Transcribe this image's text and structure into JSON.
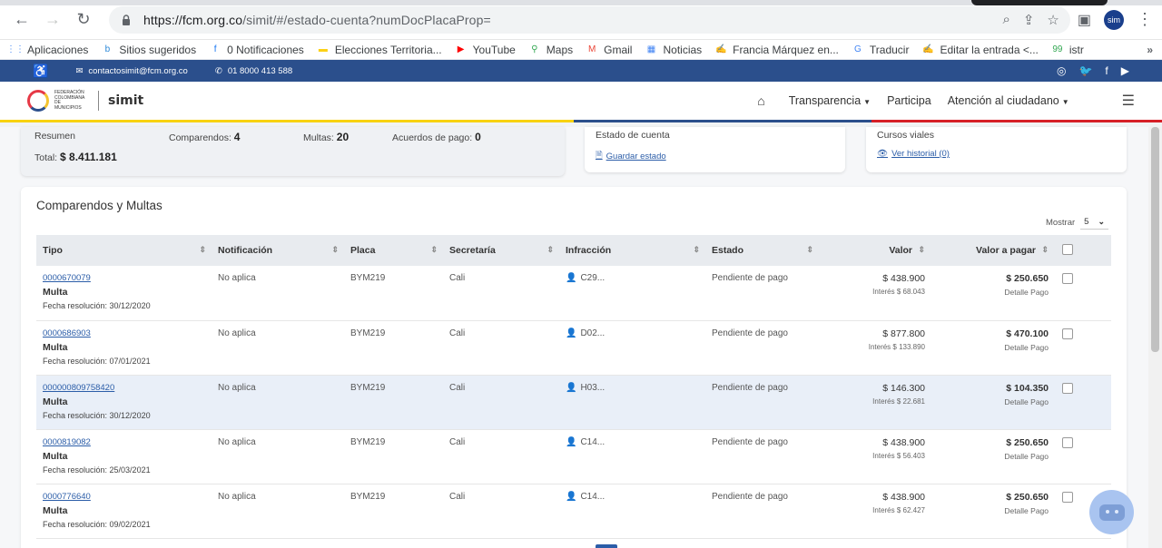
{
  "browser": {
    "url_base": "https://fcm.org.co",
    "url_path": "/simit/#/estado-cuenta?numDocPlacaProp=",
    "profile_label": "sim"
  },
  "bookmarks": [
    {
      "label": "Aplicaciones",
      "icon": "apps-grid-icon",
      "color": "#4285f4"
    },
    {
      "label": "Sitios sugeridos",
      "icon": "bing-icon",
      "color": "#2b88d8"
    },
    {
      "label": "0 Notificaciones",
      "icon": "facebook-icon",
      "color": "#1877f2"
    },
    {
      "label": "Elecciones Territoria...",
      "icon": "flag-icon",
      "color": "#fcd116"
    },
    {
      "label": "YouTube",
      "icon": "youtube-icon",
      "color": "#ff0000"
    },
    {
      "label": "Maps",
      "icon": "maps-pin-icon",
      "color": "#34a853"
    },
    {
      "label": "Gmail",
      "icon": "gmail-icon",
      "color": "#ea4335"
    },
    {
      "label": "Noticias",
      "icon": "news-icon",
      "color": "#4285f4"
    },
    {
      "label": "Francia Márquez en...",
      "icon": "blogger-icon",
      "color": "#3b5998"
    },
    {
      "label": "Traducir",
      "icon": "translate-icon",
      "color": "#4285f4"
    },
    {
      "label": "Editar la entrada <...",
      "icon": "blogger-icon",
      "color": "#3b5998"
    },
    {
      "label": "istr",
      "icon": "istr-icon",
      "color": "#34a853"
    }
  ],
  "topbar": {
    "email": "contactosimit@fcm.org.co",
    "phone": "01 8000 413 588"
  },
  "nav": {
    "transparencia": "Transparencia",
    "participa": "Participa",
    "atencion": "Atención al ciudadano"
  },
  "logo": {
    "fcm": "Federación Colombiana de Municipios",
    "simit": "simit"
  },
  "summary": {
    "resumen": "Resumen",
    "comparendos_label": "Comparendos:",
    "comparendos": "4",
    "multas_label": "Multas:",
    "multas": "20",
    "acuerdos_label": "Acuerdos de pago:",
    "acuerdos": "0",
    "total_label": "Total:",
    "total": "$ 8.411.181"
  },
  "estado_card": {
    "title": "Estado de cuenta",
    "link": "Guardar estado"
  },
  "cursos_card": {
    "title": "Cursos viales",
    "link": "Ver historial (0)"
  },
  "main": {
    "title": "Comparendos y Multas",
    "mostrar_label": "Mostrar",
    "mostrar_value": "5"
  },
  "table": {
    "headers": {
      "tipo": "Tipo",
      "notificacion": "Notificación",
      "placa": "Placa",
      "secretaria": "Secretaría",
      "infraccion": "Infracción",
      "estado": "Estado",
      "valor": "Valor",
      "valor_pagar": "Valor a pagar"
    },
    "rows": [
      {
        "doc": "0000670079",
        "tipo": "Multa",
        "fecha": "Fecha resolución: 30/12/2020",
        "notificacion": "No aplica",
        "placa": "BYM219",
        "secretaria": "Cali",
        "infraccion": "C29...",
        "estado": "Pendiente de pago",
        "valor": "$ 438.900",
        "interes": "Interés $ 68.043",
        "pagar": "$ 250.650",
        "detalle": "Detalle Pago"
      },
      {
        "doc": "0000686903",
        "tipo": "Multa",
        "fecha": "Fecha resolución: 07/01/2021",
        "notificacion": "No aplica",
        "placa": "BYM219",
        "secretaria": "Cali",
        "infraccion": "D02...",
        "estado": "Pendiente de pago",
        "valor": "$ 877.800",
        "interes": "Interés $ 133.890",
        "pagar": "$ 470.100",
        "detalle": "Detalle Pago"
      },
      {
        "doc": "000000809758420",
        "tipo": "Multa",
        "fecha": "Fecha resolución: 30/12/2020",
        "notificacion": "No aplica",
        "placa": "BYM219",
        "secretaria": "Cali",
        "infraccion": "H03...",
        "estado": "Pendiente de pago",
        "valor": "$ 146.300",
        "interes": "Interés $ 22.681",
        "pagar": "$ 104.350",
        "detalle": "Detalle Pago",
        "highlight": true
      },
      {
        "doc": "0000819082",
        "tipo": "Multa",
        "fecha": "Fecha resolución: 25/03/2021",
        "notificacion": "No aplica",
        "placa": "BYM219",
        "secretaria": "Cali",
        "infraccion": "C14...",
        "estado": "Pendiente de pago",
        "valor": "$ 438.900",
        "interes": "Interés $ 56.403",
        "pagar": "$ 250.650",
        "detalle": "Detalle Pago"
      },
      {
        "doc": "0000776640",
        "tipo": "Multa",
        "fecha": "Fecha resolución: 09/02/2021",
        "notificacion": "No aplica",
        "placa": "BYM219",
        "secretaria": "Cali",
        "infraccion": "C14...",
        "estado": "Pendiente de pago",
        "valor": "$ 438.900",
        "interes": "Interés $ 62.427",
        "pagar": "$ 250.650",
        "detalle": "Detalle Pago"
      }
    ]
  },
  "colors": {
    "brand_blue": "#2b4f8c",
    "yellow": "#f8d210",
    "red": "#d62027",
    "link": "#2b5da8"
  }
}
